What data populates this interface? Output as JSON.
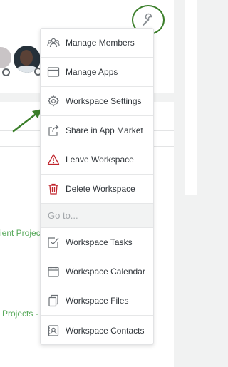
{
  "background": {
    "project_link_1": "ient Projec",
    "project_link_2": "Projects -"
  },
  "menu": {
    "items": [
      {
        "label": "Manage Members",
        "icon": "members-icon"
      },
      {
        "label": "Manage Apps",
        "icon": "apps-window-icon"
      },
      {
        "label": "Workspace Settings",
        "icon": "gear-icon"
      },
      {
        "label": "Share in App Market",
        "icon": "share-icon"
      },
      {
        "label": "Leave Workspace",
        "icon": "warning-icon",
        "icon_color": "#c0232b"
      },
      {
        "label": "Delete Workspace",
        "icon": "trash-icon",
        "icon_color": "#c0232b"
      }
    ],
    "section_label": "Go to...",
    "goto_items": [
      {
        "label": "Workspace Tasks",
        "icon": "checkbox-icon"
      },
      {
        "label": "Workspace Calendar",
        "icon": "calendar-icon"
      },
      {
        "label": "Workspace Files",
        "icon": "files-icon"
      },
      {
        "label": "Workspace Contacts",
        "icon": "contacts-icon"
      }
    ]
  },
  "colors": {
    "annotation_green": "#3b7f2a",
    "link_green": "#57a95a",
    "danger_red": "#c0232b",
    "menu_text": "#30353a"
  }
}
